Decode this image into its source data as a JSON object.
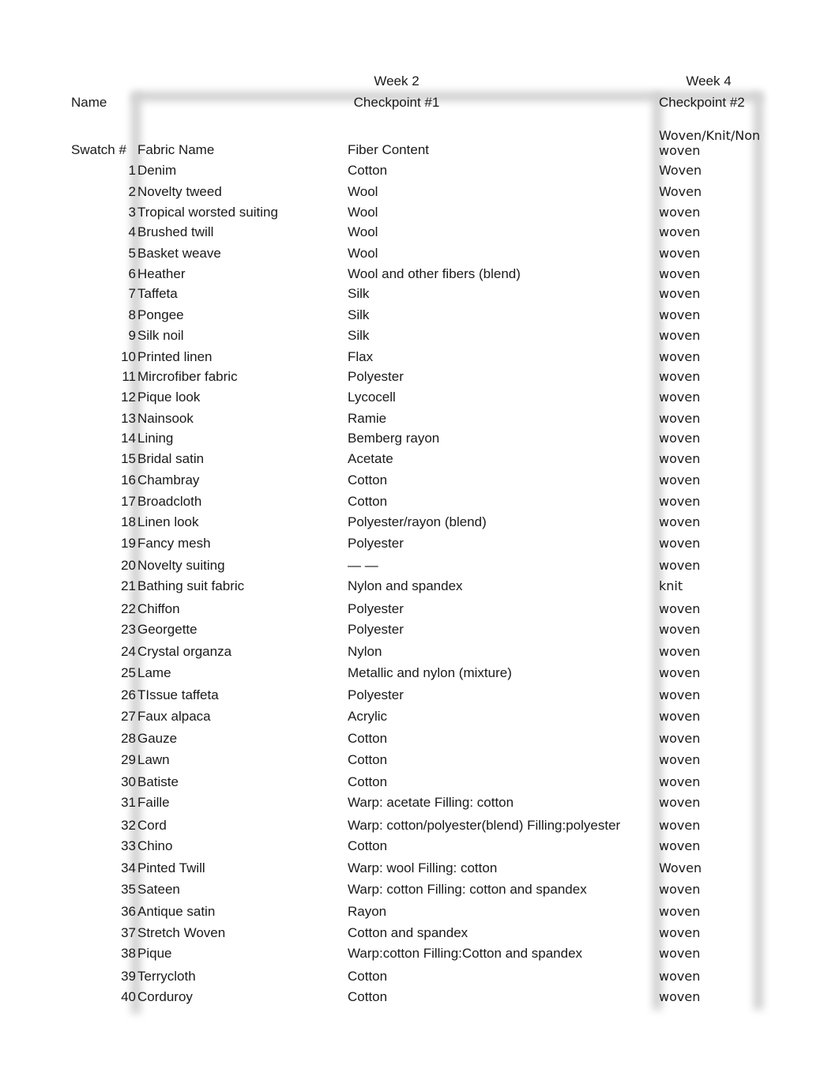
{
  "header": {
    "name_label": "Name",
    "week2_label": "Week 2",
    "checkpoint1_label": "Checkpoint #1",
    "week4_label": "Week 4",
    "checkpoint2_label": "Checkpoint #2"
  },
  "columns": {
    "swatch": "Swatch #",
    "fabric_name": "Fabric Name",
    "fiber_content": "Fiber Content",
    "structure": "Woven/Knit/Nonwoven"
  },
  "rows": [
    {
      "num": "1",
      "fabric": "Denim",
      "fiber": "Cotton",
      "type": "Woven"
    },
    {
      "num": "2",
      "fabric": "Novelty tweed",
      "fiber": "Wool",
      "type": "Woven"
    },
    {
      "num": "3",
      "fabric": "Tropical worsted suiting",
      "fiber": "Wool",
      "type": "woven"
    },
    {
      "num": "4",
      "fabric": "Brushed twill",
      "fiber": "Wool",
      "type": "woven"
    },
    {
      "num": "5",
      "fabric": "Basket weave",
      "fiber": "Wool",
      "type": "woven"
    },
    {
      "num": "6",
      "fabric": "Heather",
      "fiber": "Wool and other fibers (blend)",
      "type": "woven"
    },
    {
      "num": "7",
      "fabric": "Taffeta",
      "fiber": "Silk",
      "type": "woven"
    },
    {
      "num": "8",
      "fabric": "Pongee",
      "fiber": "Silk",
      "type": "woven"
    },
    {
      "num": "9",
      "fabric": "Silk noil",
      "fiber": "Silk",
      "type": "woven"
    },
    {
      "num": "10",
      "fabric": "Printed linen",
      "fiber": "Flax",
      "type": "woven"
    },
    {
      "num": "11",
      "fabric": "Mircrofiber fabric",
      "fiber": "Polyester",
      "type": "woven"
    },
    {
      "num": "12",
      "fabric": "Pique look",
      "fiber": "Lycocell",
      "type": "woven"
    },
    {
      "num": "13",
      "fabric": "Nainsook",
      "fiber": "Ramie",
      "type": "woven"
    },
    {
      "num": "14",
      "fabric": "Lining",
      "fiber": "Bemberg  rayon",
      "type": "woven"
    },
    {
      "num": "15",
      "fabric": "Bridal satin",
      "fiber": "Acetate",
      "type": "woven"
    },
    {
      "num": "16",
      "fabric": "Chambray",
      "fiber": "Cotton",
      "type": "woven"
    },
    {
      "num": "17",
      "fabric": "Broadcloth",
      "fiber": "Cotton",
      "type": "woven"
    },
    {
      "num": "18",
      "fabric": "Linen look",
      "fiber": "Polyester/rayon (blend)",
      "type": "woven"
    },
    {
      "num": "19",
      "fabric": "Fancy mesh",
      "fiber": "Polyester",
      "type": "woven"
    },
    {
      "num": "20",
      "fabric": "Novelty suiting",
      "fiber": "— —",
      "type": "woven"
    },
    {
      "num": "21",
      "fabric": "Bathing suit fabric",
      "fiber": "Nylon and spandex",
      "type": "knit"
    },
    {
      "num": "22",
      "fabric": "Chiffon",
      "fiber": "Polyester",
      "type": "woven"
    },
    {
      "num": "23",
      "fabric": "Georgette",
      "fiber": "Polyester",
      "type": "woven"
    },
    {
      "num": "24",
      "fabric": "Crystal organza",
      "fiber": "Nylon",
      "type": "woven"
    },
    {
      "num": "25",
      "fabric": "Lame",
      "fiber": "Metallic and nylon (mixture)",
      "type": "woven"
    },
    {
      "num": "26",
      "fabric": "TIssue taffeta",
      "fiber": "Polyester",
      "type": "woven"
    },
    {
      "num": "27",
      "fabric": "Faux alpaca",
      "fiber": "Acrylic",
      "type": "woven"
    },
    {
      "num": "28",
      "fabric": "Gauze",
      "fiber": "Cotton",
      "type": "woven"
    },
    {
      "num": "29",
      "fabric": "Lawn",
      "fiber": "Cotton",
      "type": "woven"
    },
    {
      "num": "30",
      "fabric": "Batiste",
      "fiber": "Cotton",
      "type": "woven"
    },
    {
      "num": "31",
      "fabric": "Faille",
      "fiber": "Warp: acetate Filling: cotton",
      "type": "woven"
    },
    {
      "num": "32",
      "fabric": "Cord",
      "fiber": "Warp: cotton/polyester(blend) Filling:polyester",
      "type": "woven"
    },
    {
      "num": "33",
      "fabric": "Chino",
      "fiber": "Cotton",
      "type": "woven"
    },
    {
      "num": "34",
      "fabric": "Pinted Twill",
      "fiber": "Warp: wool  Filling: cotton",
      "type": "Woven"
    },
    {
      "num": "35",
      "fabric": "Sateen",
      "fiber": "Warp: cotton Filling: cotton and spandex",
      "type": "woven"
    },
    {
      "num": "36",
      "fabric": "Antique satin",
      "fiber": "Rayon",
      "type": "woven"
    },
    {
      "num": "37",
      "fabric": "Stretch Woven",
      "fiber": "Cotton and spandex",
      "type": "woven"
    },
    {
      "num": "38",
      "fabric": "Pique",
      "fiber": "Warp:cotton Filling:Cotton and spandex",
      "type": "woven"
    },
    {
      "num": "39",
      "fabric": "Terrycloth",
      "fiber": "Cotton",
      "type": "woven"
    },
    {
      "num": "40",
      "fabric": "Corduroy",
      "fiber": "Cotton",
      "type": "woven"
    }
  ]
}
